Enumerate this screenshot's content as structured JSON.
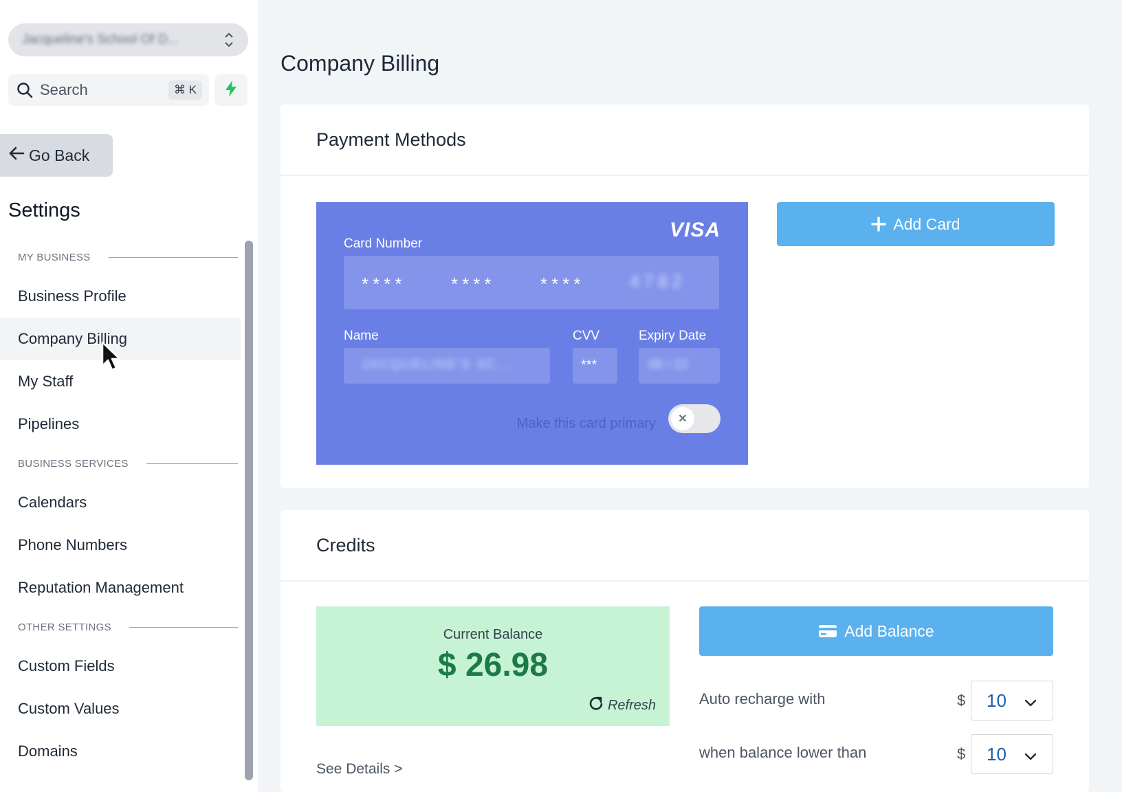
{
  "sidebar": {
    "account_name": "Jacqueline's School Of D...",
    "search_label": "Search",
    "search_shortcut": "⌘ K",
    "go_back": "Go Back",
    "settings_title": "Settings",
    "sections": [
      {
        "title": "MY BUSINESS",
        "items": [
          "Business Profile",
          "Company Billing",
          "My Staff",
          "Pipelines"
        ]
      },
      {
        "title": "BUSINESS SERVICES",
        "items": [
          "Calendars",
          "Phone Numbers",
          "Reputation Management"
        ]
      },
      {
        "title": "OTHER SETTINGS",
        "items": [
          "Custom Fields",
          "Custom Values",
          "Domains"
        ]
      }
    ],
    "active_item": "Company Billing"
  },
  "main": {
    "page_title": "Company Billing",
    "payment_methods": {
      "title": "Payment Methods",
      "card": {
        "brand": "VISA",
        "card_number_label": "Card Number",
        "groups": [
          "****",
          "****",
          "****"
        ],
        "last_four": "4782",
        "name_label": "Name",
        "name_value": "JACQUELINE'S SC...",
        "cvv_label": "CVV",
        "cvv_value": "***",
        "expiry_label": "Expiry Date",
        "expiry_value": "06 / 22",
        "primary_label": "Make this card primary",
        "primary_toggle": false
      },
      "add_card_label": "Add Card"
    },
    "credits": {
      "title": "Credits",
      "current_balance_label": "Current Balance",
      "current_balance_value": "$ 26.98",
      "refresh_label": "Refresh",
      "see_details": "See Details >",
      "add_balance_label": "Add Balance",
      "auto_recharge_label": "Auto recharge with",
      "auto_recharge_currency": "$",
      "auto_recharge_value": "10",
      "threshold_label": "when balance lower than",
      "threshold_currency": "$",
      "threshold_value": "10"
    }
  },
  "colors": {
    "card_blue": "#6a7fe6",
    "button_blue": "#5bb1ee",
    "balance_green_bg": "#c6f3d4",
    "balance_green_text": "#1d7a46",
    "bolt_green": "#22c55e"
  }
}
